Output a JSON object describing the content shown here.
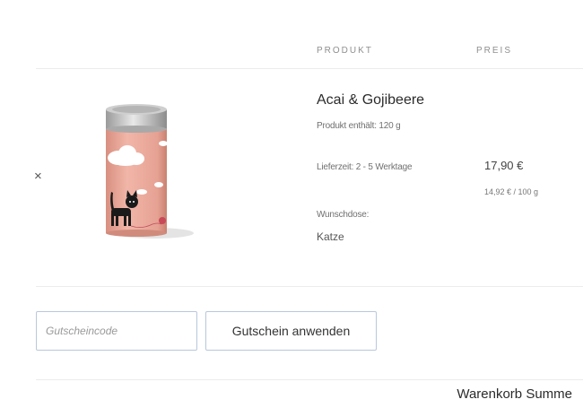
{
  "table": {
    "header_product": "PRODUKT",
    "header_price": "PREIS"
  },
  "cart_item": {
    "remove_symbol": "×",
    "image_icon": "tea-can-cat-illustration",
    "name": "Acai & Gojibeere",
    "contents": "Produkt enthält: 120 g",
    "delivery": "Lieferzeit: 2 - 5 Werktage",
    "wish_label": "Wunschdose:",
    "wish_value": "Katze",
    "price": "17,90 €",
    "unit_price": "14,92 € / 100 g"
  },
  "coupon": {
    "placeholder": "Gutscheincode",
    "value": "",
    "button_label": "Gutschein anwenden"
  },
  "summary": {
    "title": "Warenkorb Summe"
  },
  "colors": {
    "can_pink": "#e8a89a",
    "input_border": "#b8c8dc",
    "divider": "#ececec"
  }
}
